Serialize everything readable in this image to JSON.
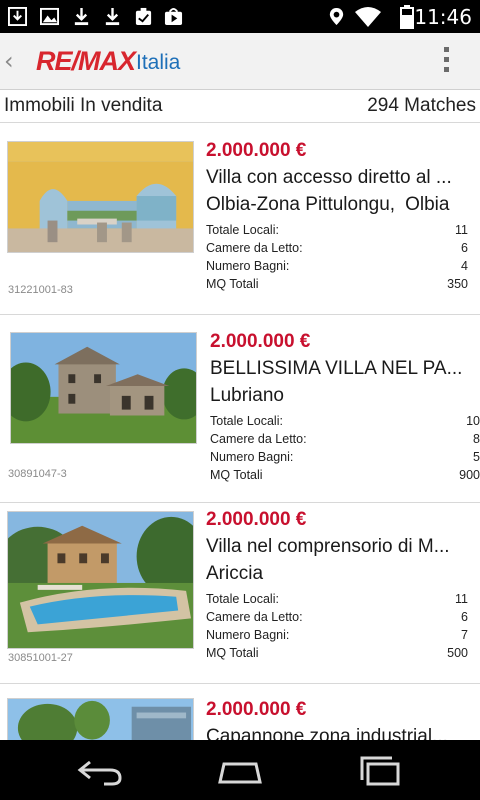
{
  "status_bar": {
    "time": "11:46",
    "icons": [
      "download-arrow-icon",
      "image-icon",
      "download-icon",
      "download-icon",
      "clipboard-check-icon",
      "play-store-icon",
      "location-pin-icon",
      "wifi-icon",
      "battery-icon"
    ]
  },
  "app_bar": {
    "logo_brand": "RE/MAX",
    "logo_country": "Italia",
    "back_icon": "chevron-left-icon",
    "menu_icon": "overflow-menu-icon"
  },
  "sub_header": {
    "title": "Immobili In vendita",
    "matches": "294 Matches"
  },
  "colors": {
    "price": "#c8102e",
    "brand_red": "#d8262e",
    "brand_blue": "#1d6fb8",
    "app_bar_bg": "#f2f2f2"
  },
  "listings": [
    {
      "price": "2.000.000 €",
      "title": "Villa con accesso diretto al ...",
      "location": "Olbia-Zona Pittulongu,",
      "city": "Olbia",
      "ref": "31221001-83",
      "specs": [
        {
          "label": "Totale Locali:",
          "value": "11"
        },
        {
          "label": "Camere da Letto:",
          "value": "6"
        },
        {
          "label": "Numero Bagni:",
          "value": "4"
        },
        {
          "label": "MQ Totali",
          "value": "350"
        }
      ]
    },
    {
      "price": "2.000.000 €",
      "title": "BELLISSIMA VILLA NEL PA...",
      "location": "Lubriano",
      "city": "",
      "ref": "30891047-3",
      "specs": [
        {
          "label": "Totale Locali:",
          "value": "10"
        },
        {
          "label": "Camere da Letto:",
          "value": "8"
        },
        {
          "label": "Numero Bagni:",
          "value": "5"
        },
        {
          "label": "MQ Totali",
          "value": "900"
        }
      ]
    },
    {
      "price": "2.000.000 €",
      "title": "Villa nel comprensorio di M...",
      "location": "Ariccia",
      "city": "",
      "ref": "30851001-27",
      "specs": [
        {
          "label": "Totale Locali:",
          "value": "11"
        },
        {
          "label": "Camere da Letto:",
          "value": "6"
        },
        {
          "label": "Numero Bagni:",
          "value": "7"
        },
        {
          "label": "MQ Totali",
          "value": "500"
        }
      ]
    },
    {
      "price": "2.000.000 €",
      "title": "Capannone zona industrial...",
      "location": "",
      "city": "",
      "ref": "",
      "specs": []
    }
  ],
  "nav_bar": {
    "icons": [
      "back-icon",
      "home-icon",
      "recent-apps-icon"
    ]
  }
}
